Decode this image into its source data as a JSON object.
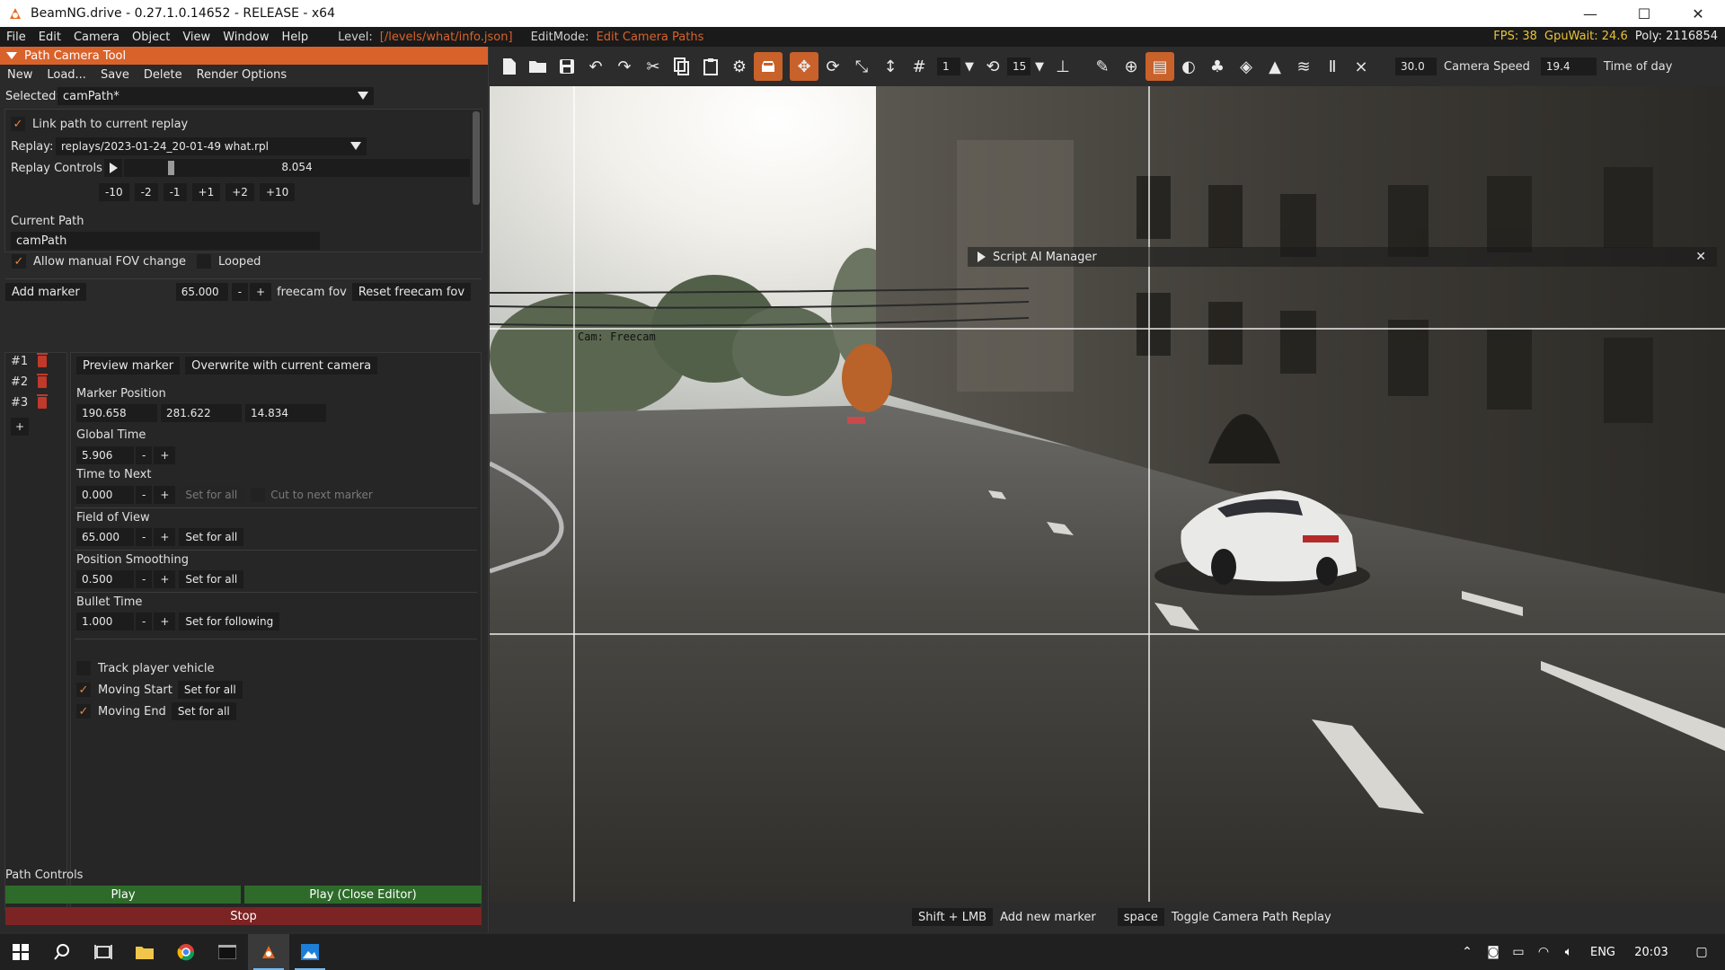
{
  "window": {
    "title": "BeamNG.drive - 0.27.1.0.14652 - RELEASE - x64",
    "minimize": "—",
    "maximize": "☐",
    "close": "✕"
  },
  "menubar": {
    "items": [
      "File",
      "Edit",
      "Camera",
      "Object",
      "View",
      "Window",
      "Help"
    ],
    "level_label": "Level:",
    "level_value": "[/levels/what/info.json]",
    "editmode_label": "EditMode:",
    "editmode_value": "Edit Camera Paths",
    "fps": "FPS: 38",
    "gpuwait": "GpuWait: 24.6",
    "poly": "Poly: 2116854"
  },
  "path_tool": {
    "title": "Path Camera Tool",
    "menu": [
      "New",
      "Load...",
      "Save",
      "Delete",
      "Render Options"
    ],
    "selected_label": "Selected:",
    "selected_value": "camPath*",
    "link_path_label": "Link path to current replay",
    "replay_label": "Replay:",
    "replay_value": "replays/2023-01-24_20-01-49 what.rpl",
    "replay_controls_label": "Replay Controls",
    "replay_time": "8.054",
    "replay_progress": 0.13,
    "step_buttons": [
      "-10",
      "-2",
      "-1",
      "+1",
      "+2",
      "+10"
    ],
    "current_path_label": "Current Path",
    "current_path_value": "camPath",
    "allow_fov_label": "Allow manual FOV change",
    "looped_label": "Looped",
    "add_marker_label": "Add marker",
    "fov_value": "65.000",
    "minus": "-",
    "plus": "+",
    "freecam_fov_label": "freecam fov",
    "reset_freecam_label": "Reset freecam fov",
    "markers": [
      "#1",
      "#2",
      "#3"
    ],
    "add_plus": "+",
    "preview_marker": "Preview marker",
    "overwrite_camera": "Overwrite with current camera",
    "marker_position_label": "Marker Position",
    "pos_x": "190.658",
    "pos_y": "281.622",
    "pos_z": "14.834",
    "global_time_label": "Global Time",
    "global_time_value": "5.906",
    "time_to_next_label": "Time to Next",
    "time_to_next_value": "0.000",
    "set_for_all": "Set for all",
    "cut_to_next": "Cut to next marker",
    "fov_label": "Field of View",
    "fov_marker_value": "65.000",
    "smoothing_label": "Position Smoothing",
    "smoothing_value": "0.500",
    "bullet_label": "Bullet Time",
    "bullet_value": "1.000",
    "set_for_following": "Set for following",
    "track_player_label": "Track player vehicle",
    "moving_start_label": "Moving Start",
    "moving_end_label": "Moving End",
    "path_controls_label": "Path Controls",
    "play": "Play",
    "play_close": "Play (Close Editor)",
    "stop": "Stop",
    "colors": {
      "accent": "#d9622b",
      "play": "#2e6b2a",
      "stop": "#7c2323"
    }
  },
  "toolbar": {
    "snap_value": "1",
    "angle_value": "15",
    "camera_speed_value": "30.0",
    "camera_speed_label": "Camera Speed",
    "time_of_day_value": "19.4",
    "time_of_day_label": "Time of day"
  },
  "viewport": {
    "cam_label": "Cam: Freecam",
    "script_ai_label": "Script AI Manager",
    "close_icon": "✕"
  },
  "statusbar": {
    "key1": "Shift + LMB",
    "action1": "Add new marker",
    "key2": "space",
    "action2": "Toggle Camera Path Replay"
  },
  "taskbar": {
    "lang": "ENG",
    "time": "20:03"
  }
}
